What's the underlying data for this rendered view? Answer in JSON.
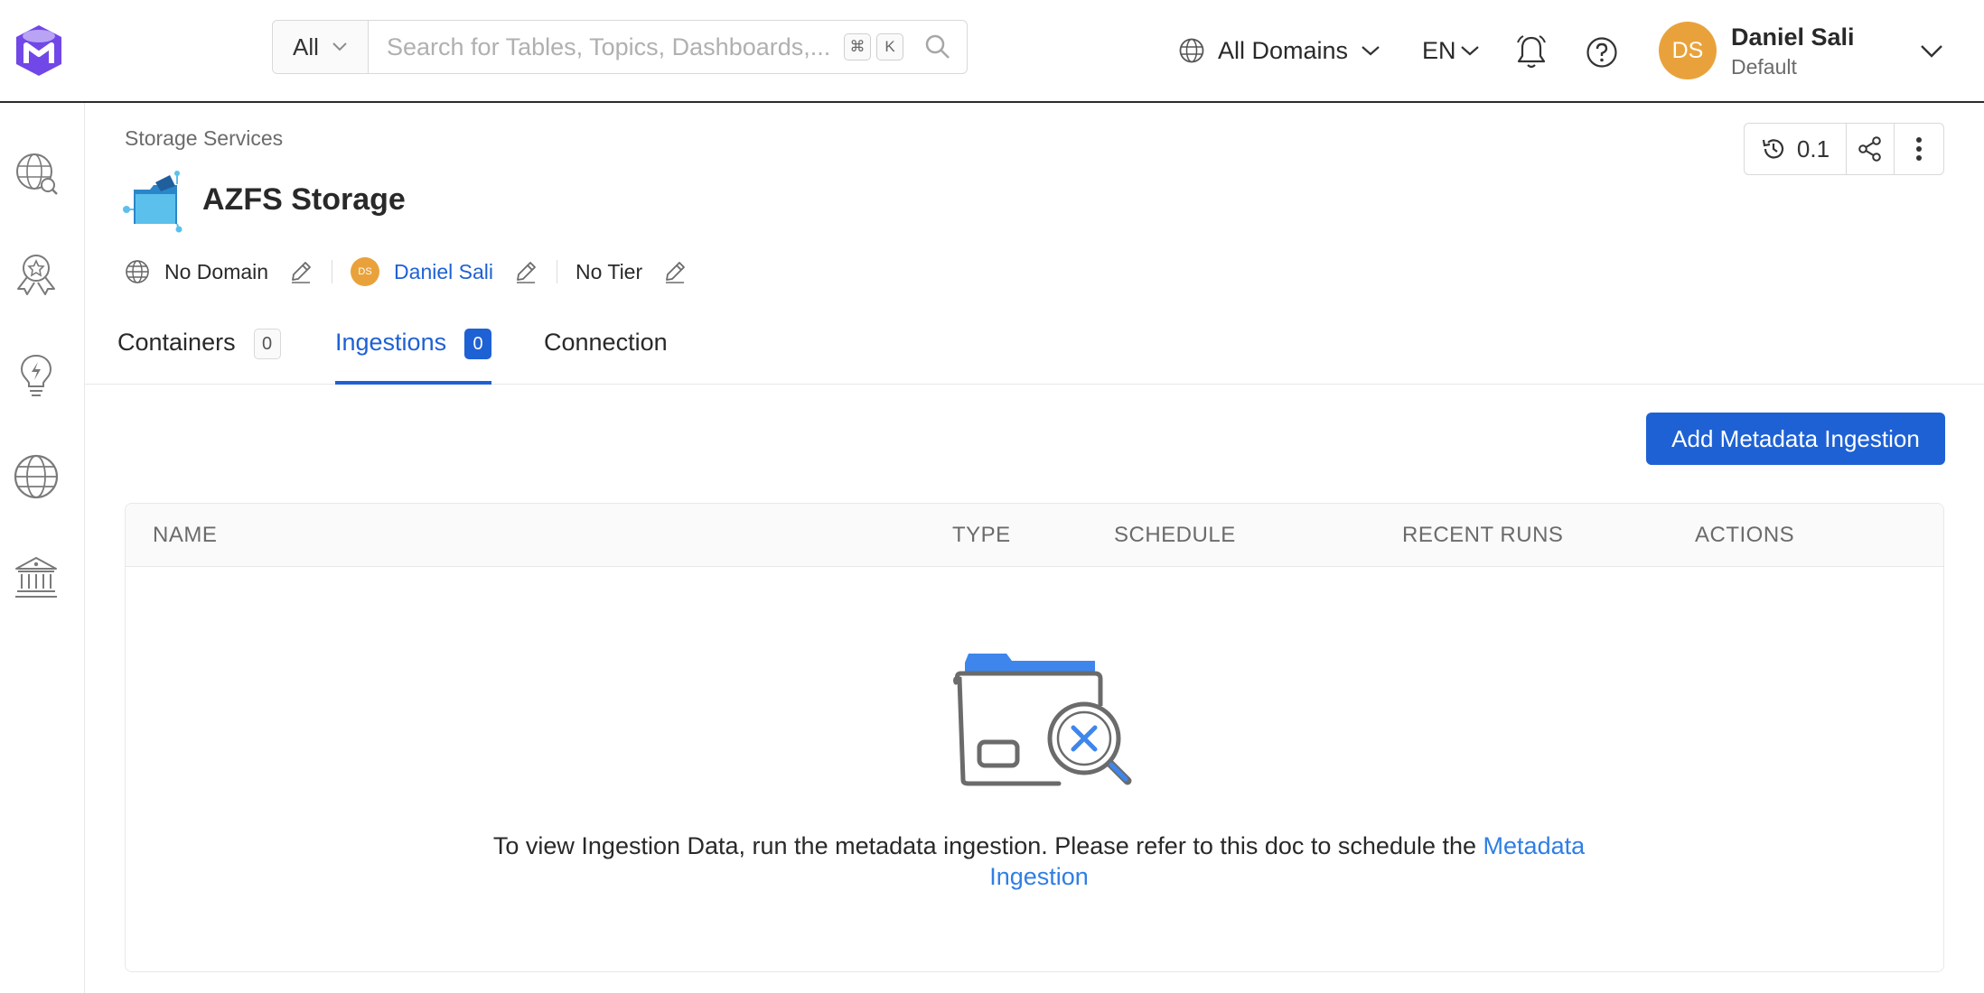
{
  "header": {
    "search": {
      "scope": "All",
      "placeholder": "Search for Tables, Topics, Dashboards,...",
      "shortcut_key": "K"
    },
    "domain_selector": "All Domains",
    "language": "EN",
    "user": {
      "initials": "DS",
      "name": "Daniel Sali",
      "role": "Default"
    }
  },
  "sidebar": {
    "items": [
      {
        "icon": "explore-icon"
      },
      {
        "icon": "quality-badge-icon"
      },
      {
        "icon": "insights-bulb-icon"
      },
      {
        "icon": "domains-globe-icon"
      },
      {
        "icon": "governance-building-icon"
      }
    ]
  },
  "page": {
    "breadcrumb": "Storage Services",
    "title": "AZFS Storage",
    "version": "0.1",
    "domain": "No Domain",
    "owner": {
      "initials": "DS",
      "name": "Daniel Sali"
    },
    "tier": "No Tier"
  },
  "tabs": [
    {
      "label": "Containers",
      "count": "0"
    },
    {
      "label": "Ingestions",
      "count": "0"
    },
    {
      "label": "Connection"
    }
  ],
  "ingestions": {
    "add_button": "Add Metadata Ingestion",
    "columns": [
      "NAME",
      "TYPE",
      "SCHEDULE",
      "RECENT RUNS",
      "ACTIONS"
    ],
    "empty_message": "To view Ingestion Data, run the metadata ingestion. Please refer to this doc to schedule the",
    "empty_link": "Metadata Ingestion"
  },
  "colors": {
    "primary": "#1e61d4",
    "link": "#2f7ee5",
    "avatar": "#e9a23b",
    "logo": "#7147e8"
  }
}
